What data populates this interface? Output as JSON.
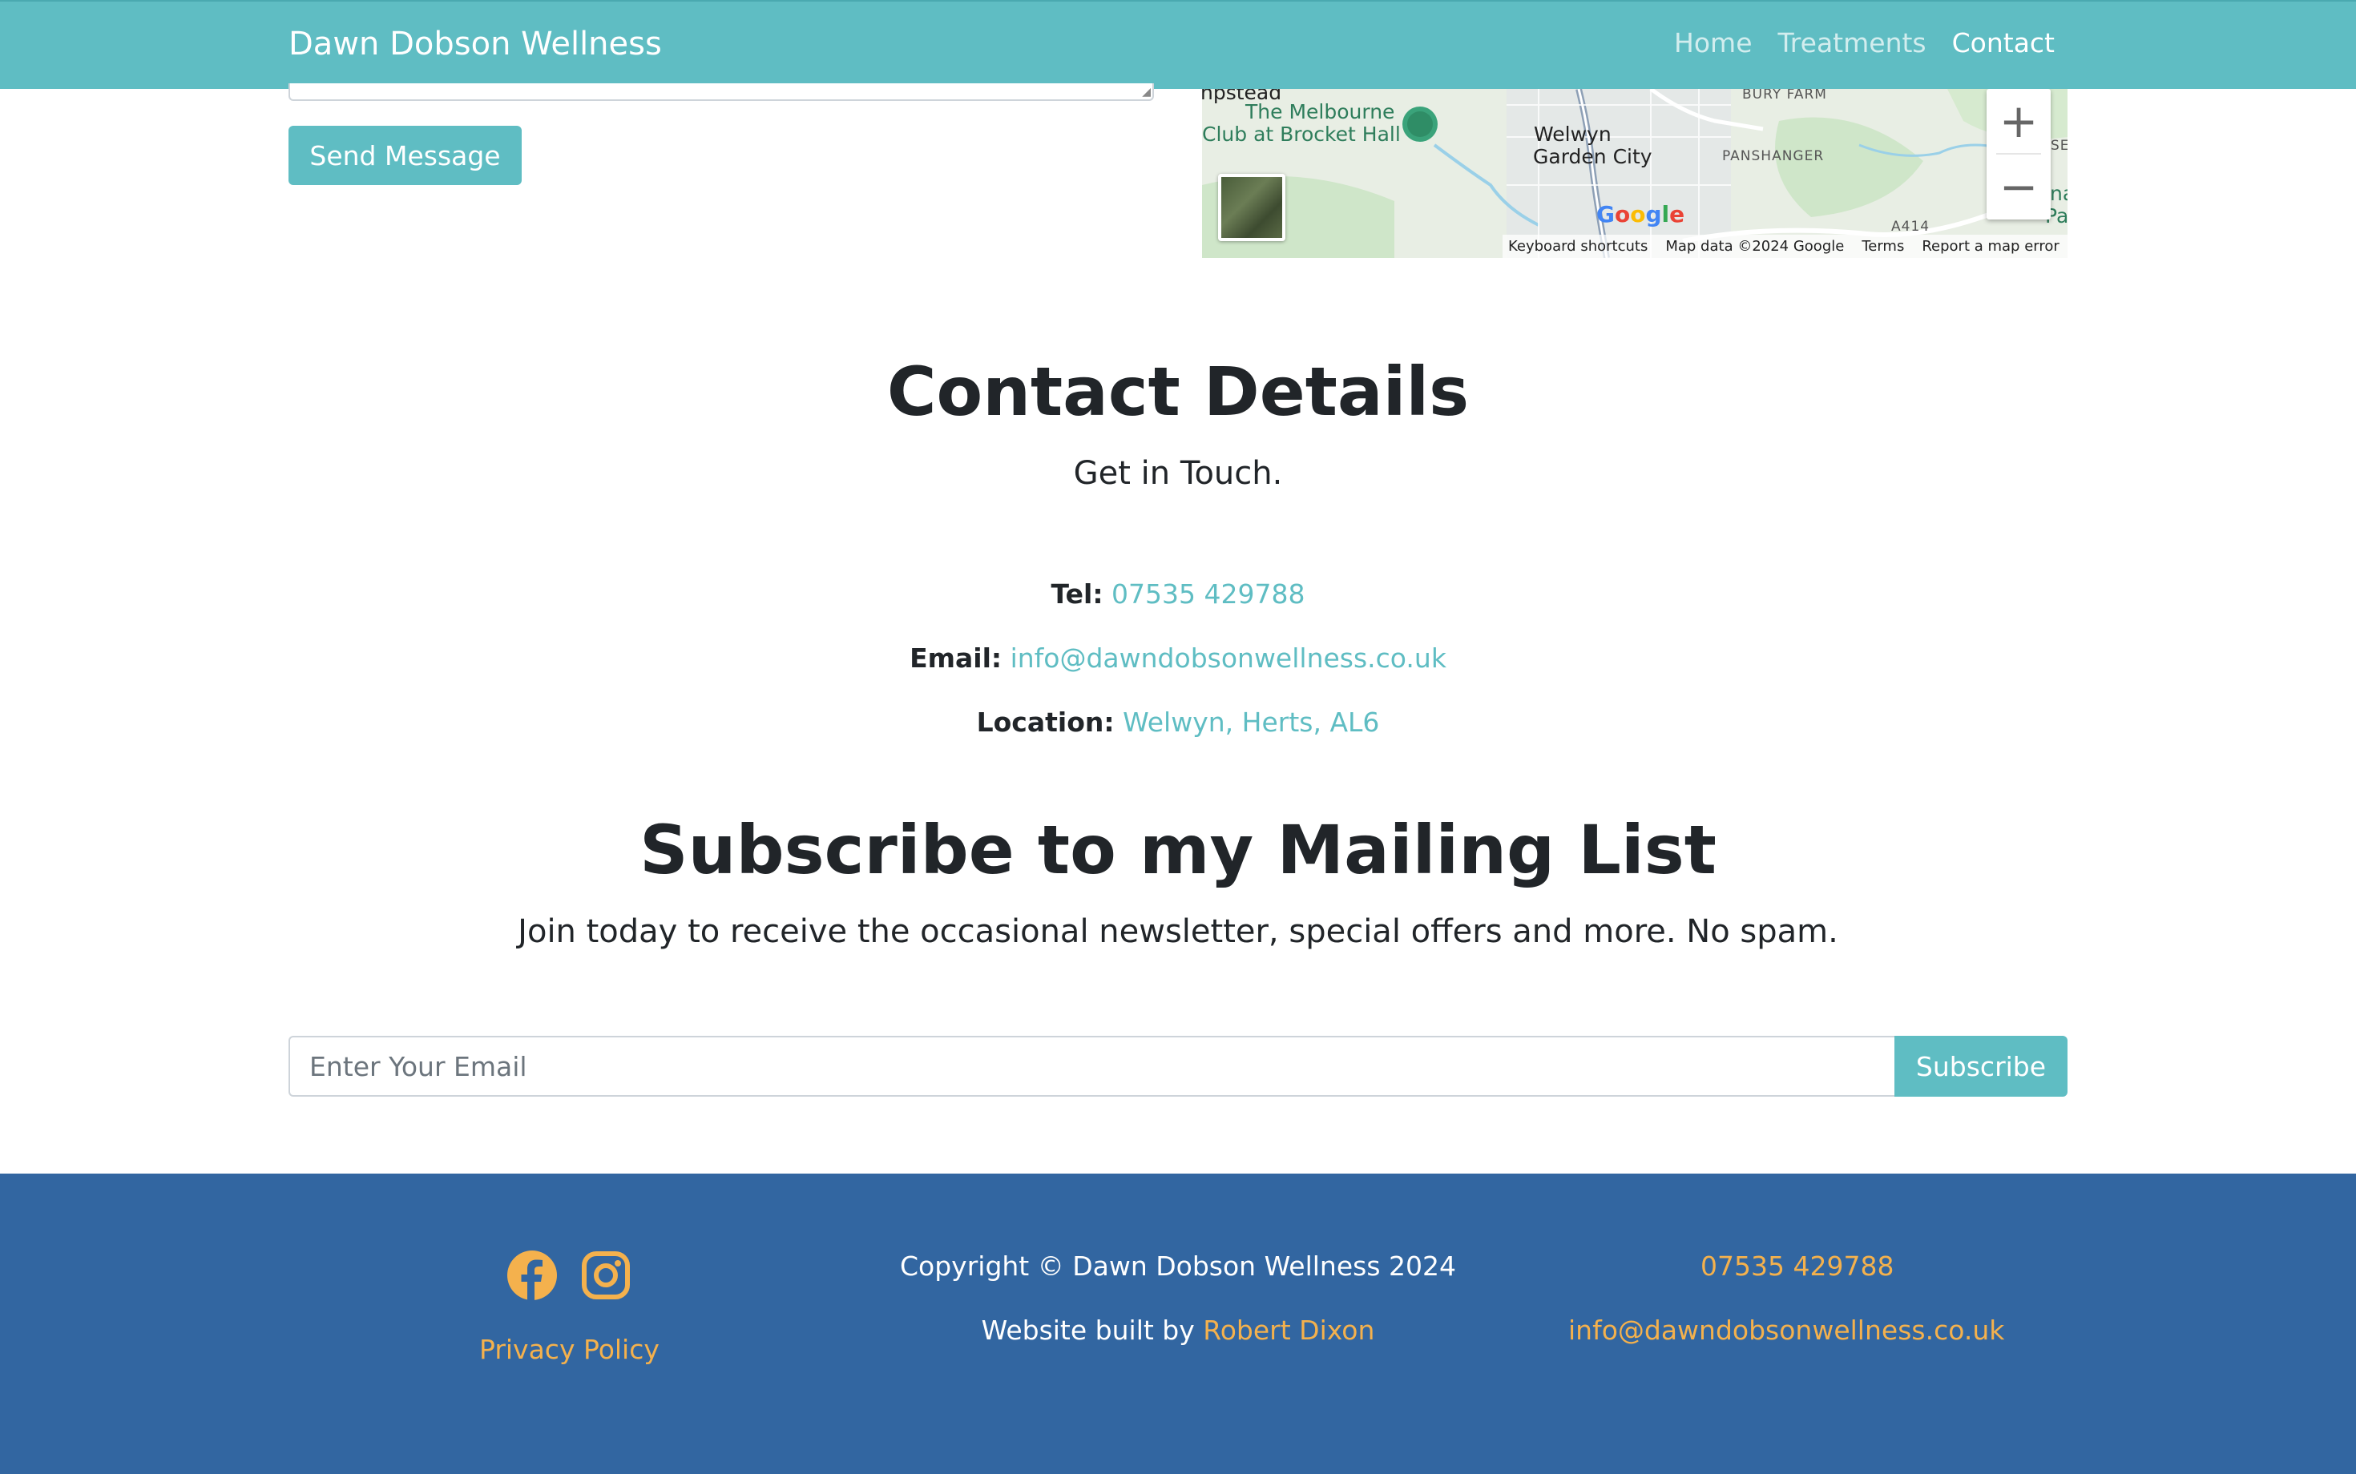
{
  "navbar": {
    "brand": "Dawn Dobson Wellness",
    "links": [
      {
        "label": "Home",
        "active": false
      },
      {
        "label": "Treatments",
        "active": false
      },
      {
        "label": "Contact",
        "active": true
      }
    ]
  },
  "form": {
    "send_label": "Send Message"
  },
  "map": {
    "labels": {
      "place_partial": "npstead",
      "melbourne_line1": "The Melbourne",
      "melbourne_line2": "Club at Brocket Hall",
      "welwyn_line1": "Welwyn",
      "welwyn_line2": "Garden City",
      "bury_farm": "BURY FARM",
      "panshanger": "PANSHANGER",
      "edge_1": "SE",
      "edge_2": "na",
      "edge_3": "Par",
      "road": "A414"
    },
    "zoom_in": "+",
    "zoom_out": "−",
    "google": "Google",
    "footer": {
      "shortcuts": "Keyboard shortcuts",
      "data": "Map data ©2024 Google",
      "terms": "Terms",
      "report": "Report a map error"
    }
  },
  "contact": {
    "title": "Contact Details",
    "subtitle": "Get in Touch.",
    "tel_label": "Tel:",
    "tel_value": "07535 429788",
    "email_label": "Email:",
    "email_value": "info@dawndobsonwellness.co.uk",
    "location_label": "Location:",
    "location_value": "Welwyn, Herts, AL6"
  },
  "subscribe": {
    "title": "Subscribe to my Mailing List",
    "subtitle": "Join today to receive the occasional newsletter, special offers and more. No spam.",
    "placeholder": "Enter Your Email",
    "button": "Subscribe"
  },
  "footer": {
    "privacy": "Privacy Policy",
    "copyright": "Copyright © Dawn Dobson Wellness 2024",
    "built_by_prefix": "Website built by",
    "built_by_name": "Robert Dixon",
    "phone": "07535 429788",
    "email": "info@dawndobsonwellness.co.uk",
    "icons": [
      "facebook-icon",
      "instagram-icon"
    ]
  },
  "colors": {
    "accent": "#5fbdc3",
    "footer_bg": "#3266a1",
    "footer_link": "#f4b14d",
    "text": "#212529"
  }
}
